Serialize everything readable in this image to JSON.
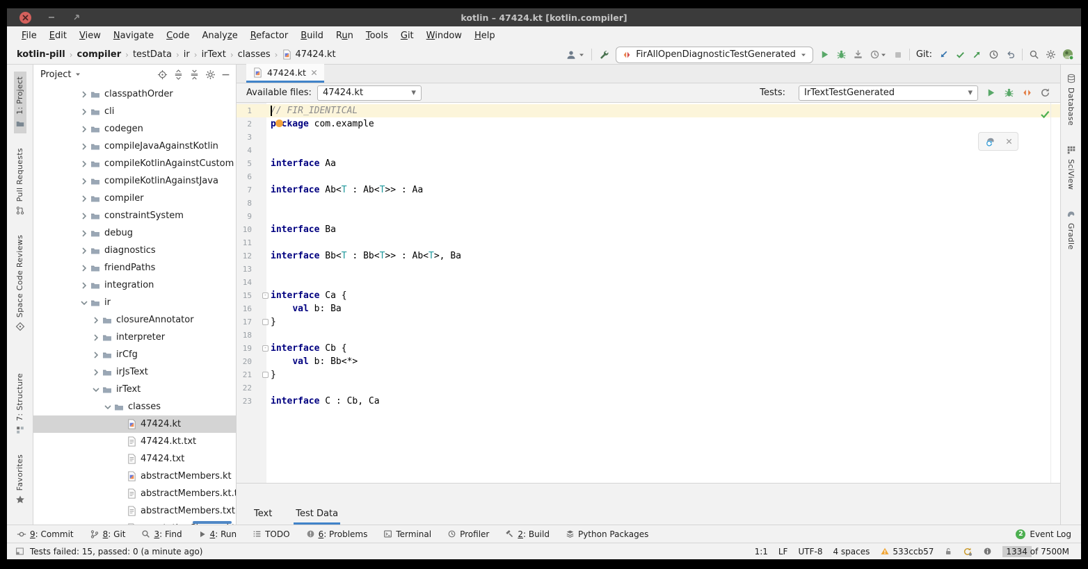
{
  "window": {
    "title": "kotlin – 47424.kt [kotlin.compiler]"
  },
  "menubar": {
    "items": [
      {
        "label": "File",
        "m": 0
      },
      {
        "label": "Edit",
        "m": 0
      },
      {
        "label": "View",
        "m": 0
      },
      {
        "label": "Navigate",
        "m": 0
      },
      {
        "label": "Code",
        "m": 0
      },
      {
        "label": "Analyze",
        "m": 5
      },
      {
        "label": "Refactor",
        "m": 0
      },
      {
        "label": "Build",
        "m": 0
      },
      {
        "label": "Run",
        "m": 1
      },
      {
        "label": "Tools",
        "m": 0
      },
      {
        "label": "Git",
        "m": 0
      },
      {
        "label": "Window",
        "m": 0
      },
      {
        "label": "Help",
        "m": 0
      }
    ]
  },
  "navbar": {
    "breadcrumbs": [
      {
        "label": "kotlin-pill",
        "bold": true
      },
      {
        "label": "compiler",
        "bold": true
      },
      {
        "label": "testData"
      },
      {
        "label": "ir"
      },
      {
        "label": "irText"
      },
      {
        "label": "classes"
      },
      {
        "label": "47424.kt",
        "icon": "kotlin-file"
      }
    ],
    "run_config": "FirAllOpenDiagnosticTestGenerated",
    "git_label": "Git:"
  },
  "left_stripe": {
    "active": 0,
    "items": [
      {
        "label": "1: Project",
        "icon": "project-folder"
      },
      {
        "label": "Pull Requests",
        "icon": "pull-request"
      },
      {
        "label": "Space Code Reviews",
        "icon": "space-reviews"
      },
      {
        "label": "7: Structure",
        "icon": "structure"
      },
      {
        "label": "Favorites",
        "icon": "star"
      }
    ]
  },
  "right_stripe": {
    "items": [
      {
        "label": "Database",
        "icon": "database"
      },
      {
        "label": "SciView",
        "icon": "sciview-grid"
      },
      {
        "label": "Gradle",
        "icon": "gradle-elephant"
      }
    ]
  },
  "project_panel": {
    "title": "Project",
    "tree": [
      {
        "label": "classpathOrder",
        "level": 0,
        "kind": "folder"
      },
      {
        "label": "cli",
        "level": 0,
        "kind": "folder"
      },
      {
        "label": "codegen",
        "level": 0,
        "kind": "folder"
      },
      {
        "label": "compileJavaAgainstKotlin",
        "level": 0,
        "kind": "folder"
      },
      {
        "label": "compileKotlinAgainstCustom",
        "level": 0,
        "kind": "folder"
      },
      {
        "label": "compileKotlinAgainstJava",
        "level": 0,
        "kind": "folder"
      },
      {
        "label": "compiler",
        "level": 0,
        "kind": "folder"
      },
      {
        "label": "constraintSystem",
        "level": 0,
        "kind": "folder"
      },
      {
        "label": "debug",
        "level": 0,
        "kind": "folder"
      },
      {
        "label": "diagnostics",
        "level": 0,
        "kind": "folder"
      },
      {
        "label": "friendPaths",
        "level": 0,
        "kind": "folder"
      },
      {
        "label": "integration",
        "level": 0,
        "kind": "folder"
      },
      {
        "label": "ir",
        "level": 0,
        "kind": "folder",
        "expanded": true
      },
      {
        "label": "closureAnnotator",
        "level": 1,
        "kind": "folder"
      },
      {
        "label": "interpreter",
        "level": 1,
        "kind": "folder"
      },
      {
        "label": "irCfg",
        "level": 1,
        "kind": "folder"
      },
      {
        "label": "irJsText",
        "level": 1,
        "kind": "folder"
      },
      {
        "label": "irText",
        "level": 1,
        "kind": "folder",
        "expanded": true
      },
      {
        "label": "classes",
        "level": 2,
        "kind": "folder",
        "expanded": true
      },
      {
        "label": "47424.kt",
        "level": 3,
        "kind": "kfile",
        "selected": true
      },
      {
        "label": "47424.kt.txt",
        "level": 3,
        "kind": "tfile"
      },
      {
        "label": "47424.txt",
        "level": 3,
        "kind": "tfile"
      },
      {
        "label": "abstractMembers.kt",
        "level": 3,
        "kind": "kfile"
      },
      {
        "label": "abstractMembers.kt.txt",
        "level": 3,
        "kind": "tfile"
      },
      {
        "label": "abstractMembers.txt",
        "level": 3,
        "kind": "tfile"
      },
      {
        "label": "annotationClasses.kt",
        "level": 3,
        "kind": "kfile"
      }
    ]
  },
  "editor": {
    "tab": {
      "label": "47424.kt"
    },
    "files_bar": {
      "label": "Available files:",
      "value": "47424.kt"
    },
    "tests_bar": {
      "label": "Tests:",
      "value": "IrTextTestGenerated"
    },
    "bottom_tabs": {
      "items": [
        "Text",
        "Test Data"
      ],
      "active": 1
    },
    "code": {
      "lines": [
        {
          "hl": true,
          "caret": true,
          "t": [
            {
              "s": "// FIR_IDENTICAL",
              "c": "cm"
            }
          ]
        },
        {
          "dot": true,
          "t": [
            {
              "s": "package",
              "c": "kw"
            },
            {
              "s": " com.example",
              "c": "pl"
            }
          ]
        },
        {
          "t": []
        },
        {
          "t": []
        },
        {
          "t": [
            {
              "s": "interface",
              "c": "kw"
            },
            {
              "s": " Aa",
              "c": "pl"
            }
          ]
        },
        {
          "t": []
        },
        {
          "t": [
            {
              "s": "interface",
              "c": "kw"
            },
            {
              "s": " Ab<",
              "c": "pl"
            },
            {
              "s": "T",
              "c": "tp"
            },
            {
              "s": " : Ab<",
              "c": "pl"
            },
            {
              "s": "T",
              "c": "tp"
            },
            {
              "s": ">> : Aa",
              "c": "pl"
            }
          ]
        },
        {
          "t": []
        },
        {
          "t": []
        },
        {
          "t": [
            {
              "s": "interface",
              "c": "kw"
            },
            {
              "s": " Ba",
              "c": "pl"
            }
          ]
        },
        {
          "t": []
        },
        {
          "t": [
            {
              "s": "interface",
              "c": "kw"
            },
            {
              "s": " Bb<",
              "c": "pl"
            },
            {
              "s": "T",
              "c": "tp"
            },
            {
              "s": " : Bb<",
              "c": "pl"
            },
            {
              "s": "T",
              "c": "tp"
            },
            {
              "s": ">> : Ab<",
              "c": "pl"
            },
            {
              "s": "T",
              "c": "tp"
            },
            {
              "s": ">, Ba",
              "c": "pl"
            }
          ]
        },
        {
          "t": []
        },
        {
          "t": []
        },
        {
          "fold": "start",
          "t": [
            {
              "s": "interface",
              "c": "kw"
            },
            {
              "s": " Ca {",
              "c": "pl"
            }
          ]
        },
        {
          "t": [
            {
              "s": "    ",
              "c": "pl"
            },
            {
              "s": "val",
              "c": "kw"
            },
            {
              "s": " b: Ba",
              "c": "pl"
            }
          ]
        },
        {
          "fold": "end",
          "t": [
            {
              "s": "}",
              "c": "pl"
            }
          ]
        },
        {
          "t": []
        },
        {
          "fold": "start",
          "t": [
            {
              "s": "interface",
              "c": "kw"
            },
            {
              "s": " Cb {",
              "c": "pl"
            }
          ]
        },
        {
          "t": [
            {
              "s": "    ",
              "c": "pl"
            },
            {
              "s": "val",
              "c": "kw"
            },
            {
              "s": " b: Bb<*>",
              "c": "pl"
            }
          ]
        },
        {
          "fold": "end",
          "t": [
            {
              "s": "}",
              "c": "pl"
            }
          ]
        },
        {
          "t": []
        },
        {
          "t": [
            {
              "s": "interface",
              "c": "kw"
            },
            {
              "s": " C : Cb, Ca",
              "c": "pl"
            }
          ]
        }
      ]
    }
  },
  "bottom_bar": {
    "left": [
      {
        "label": "9: Commit",
        "m": 0,
        "icon": "commit"
      },
      {
        "label": "8: Git",
        "m": 0,
        "icon": "branch"
      },
      {
        "label": "3: Find",
        "m": 0,
        "icon": "search-small"
      },
      {
        "label": "4: Run",
        "m": 0,
        "icon": "play-small"
      },
      {
        "label": "TODO",
        "m": -1,
        "icon": "todo-list"
      },
      {
        "label": "6: Problems",
        "m": 0,
        "icon": "problems"
      },
      {
        "label": "Terminal",
        "m": -1,
        "icon": "terminal"
      },
      {
        "label": "Profiler",
        "m": -1,
        "icon": "profiler-small"
      },
      {
        "label": "2: Build",
        "m": 0,
        "icon": "hammer"
      },
      {
        "label": "Python Packages",
        "m": -1,
        "icon": "python-packages"
      }
    ],
    "right": {
      "event_log": "Event Log",
      "badge": "2"
    }
  },
  "status_bar": {
    "message": "Tests failed: 15, passed: 0 (a minute ago)",
    "caret_pos": "1:1",
    "line_ending": "LF",
    "encoding": "UTF-8",
    "indent": "4 spaces",
    "revision": "533ccb57",
    "memory": "1334 of 7500M"
  },
  "colors": {
    "accent": "#4083c9",
    "keyword": "#000080",
    "comment": "#8c8c8c",
    "type_param": "#20999d",
    "run_green": "#59a869",
    "warning": "#f0a73a",
    "titlebar": "#3b3b3b",
    "selection": "#d4d4d4",
    "current_line": "#fcf5da"
  }
}
